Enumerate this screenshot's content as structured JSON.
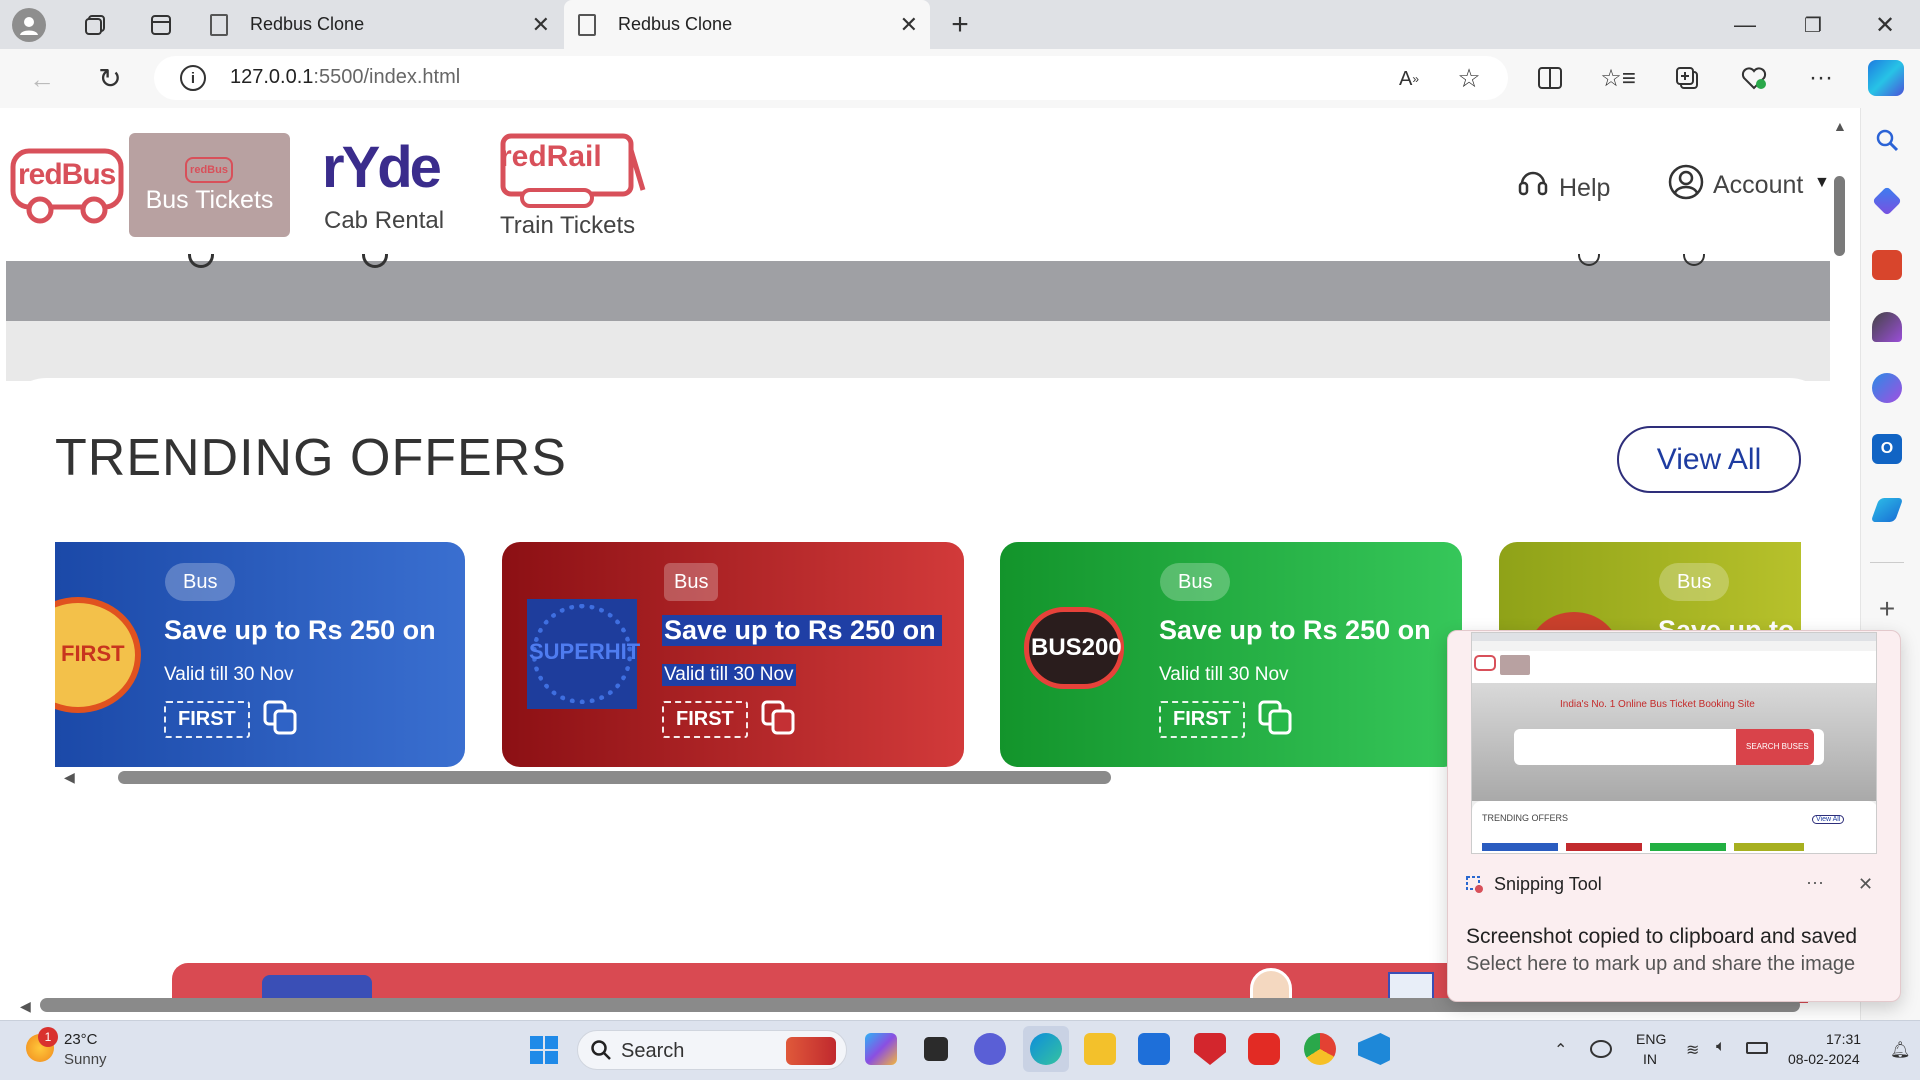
{
  "browser": {
    "tabs": [
      {
        "title": "Redbus Clone",
        "active": false
      },
      {
        "title": "Redbus Clone",
        "active": true
      }
    ],
    "url_host": "127.0.0.1",
    "url_rest": ":5500/index.html"
  },
  "header": {
    "logo_text": "redBus",
    "bus_tab": {
      "mini": "redBus",
      "label": "Bus Tickets"
    },
    "ryde": {
      "logo": "rYde",
      "label": "Cab Rental"
    },
    "rail": {
      "logo": "redRail",
      "label": "Train Tickets"
    },
    "help": "Help",
    "account": "Account"
  },
  "offers": {
    "title": "TRENDING OFFERS",
    "view_all": "View All",
    "cards": [
      {
        "tag": "Bus",
        "headline": "Save up to Rs 250 on",
        "valid": "Valid till 30 Nov",
        "code": "FIRST",
        "badge": "FIRST",
        "color": "#2a5cc0"
      },
      {
        "tag": "Bus",
        "headline": "Save up to Rs 250 on",
        "valid": "Valid till 30 Nov",
        "code": "FIRST",
        "badge": "SUPERHIT",
        "color": "#c22a2e"
      },
      {
        "tag": "Bus",
        "headline": "Save up to Rs 250 on",
        "valid": "Valid till 30 Nov",
        "code": "FIRST",
        "badge": "BUS200",
        "color": "#22b042"
      },
      {
        "tag": "Bus",
        "headline": "Save up to R",
        "color": "#a7b020"
      }
    ]
  },
  "snipping_toast": {
    "app": "Snipping Tool",
    "line1": "Screenshot copied to clipboard and saved",
    "line2": "Select here to mark up and share the image",
    "thumb_tagline": "India's No. 1 Online Bus Ticket Booking Site",
    "thumb_button": "SEARCH BUSES",
    "thumb_offers": "TRENDING OFFERS",
    "thumb_view_all": "View All"
  },
  "taskbar": {
    "weather_temp": "23°C",
    "weather_desc": "Sunny",
    "weather_badge": "1",
    "search": "Search",
    "lang1": "ENG",
    "lang2": "IN",
    "time": "17:31",
    "date": "08-02-2024"
  }
}
